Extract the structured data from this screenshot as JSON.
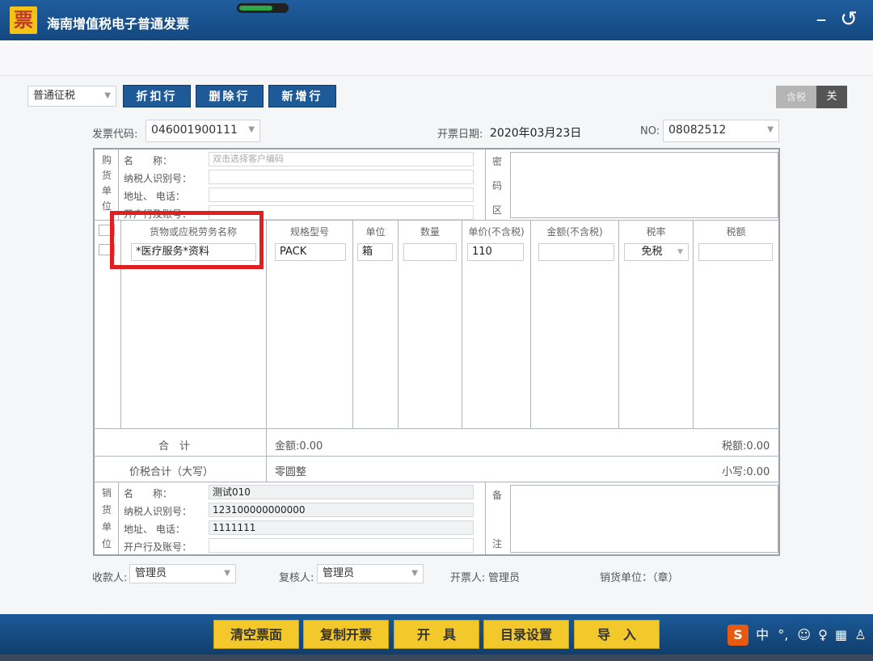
{
  "titlebar": {
    "app_icon": "票",
    "title": "海南增值税电子普通发票",
    "minimize_icon": "minimize-icon",
    "back_icon": "back-arrow-icon",
    "progress": 0.7
  },
  "toolbar": {
    "tax_mode": "普通征税",
    "btn_discount": "折扣行",
    "btn_delete": "删除行",
    "btn_add": "新增行",
    "toggle_tax_included": "含税",
    "toggle_state": "关"
  },
  "header": {
    "code_label": "发票代码:",
    "code_value": "046001900111",
    "date_label": "开票日期:",
    "date_value": "2020年03月23日",
    "no_label": "NO:",
    "no_value": "08082512"
  },
  "buyer": {
    "side_label": [
      "购",
      "货",
      "单",
      "位"
    ],
    "name_label": "名　　称：",
    "name_placeholder": "双击选择客户编码",
    "taxid_label": "纳税人识别号：",
    "address_label": "地址、 电话：",
    "bank_label": "开户行及账号："
  },
  "cipher_area": {
    "label": [
      "密",
      "码",
      "区"
    ]
  },
  "items": {
    "headers": [
      "货物或应税劳务名称",
      "规格型号",
      "单位",
      "数量",
      "单价(不含税)",
      "金额(不含税)",
      "税率",
      "税额"
    ],
    "row": {
      "name": "*医疗服务*资料",
      "spec": "PACK",
      "unit": "箱",
      "qty": "",
      "price": "110",
      "amount": "",
      "tax_rate": "免税",
      "tax": ""
    }
  },
  "totals": {
    "label": "合　计",
    "amount": "金额:0.00",
    "tax": "税额:0.00",
    "grand_label": "价税合计（大写）",
    "grand_upper": "零圆整",
    "grand_lower": "小写:0.00"
  },
  "seller": {
    "side_label": [
      "销",
      "货",
      "单",
      "位"
    ],
    "name_label": "名　　称：",
    "name_value": "测试010",
    "taxid_label": "纳税人识别号：",
    "taxid_value": "123100000000000",
    "address_label": "地址、 电话：",
    "address_value": "1111111",
    "bank_label": "开户行及账号：",
    "bank_value": ""
  },
  "remark_area": {
    "label": [
      "备",
      "注"
    ]
  },
  "signers": {
    "payee_label": "收款人:",
    "payee_value": "管理员",
    "reviewer_label": "复核人:",
    "reviewer_value": "管理员",
    "drawer_label": "开票人:",
    "drawer_value": "管理员",
    "seller_stamp": "销货单位：（章）"
  },
  "actions": {
    "clear": "清空票面",
    "copy": "复制开票",
    "issue": "开　具",
    "catalog": "目录设置",
    "import": "导　入"
  },
  "ime": {
    "logo": "S",
    "lang": "中"
  }
}
